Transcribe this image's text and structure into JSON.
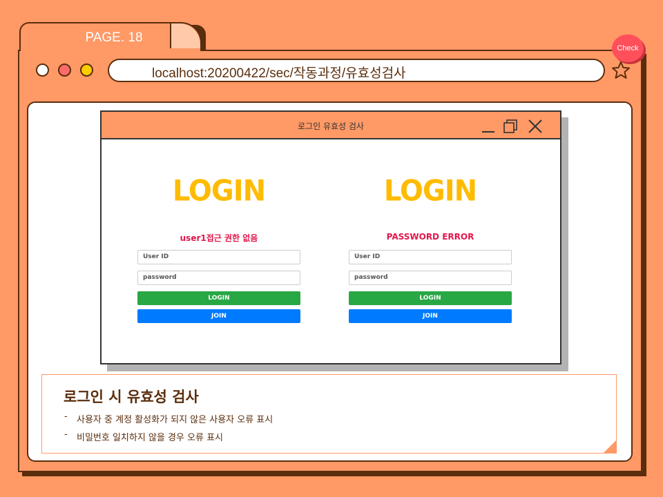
{
  "tab": {
    "title": "PAGE. 18"
  },
  "address_bar": {
    "url": "localhost:20200422/sec/작동과정/유효성검사"
  },
  "badge": {
    "label": "Check"
  },
  "window": {
    "title": "로그인 유효성 검사",
    "forms": [
      {
        "logo": "LOGIN",
        "error": "user1접근 권한 없음",
        "userid_placeholder": "User ID",
        "password_placeholder": "password",
        "login_label": "LOGIN",
        "join_label": "JOIN"
      },
      {
        "logo": "LOGIN",
        "error": "PASSWORD ERROR",
        "userid_placeholder": "User ID",
        "password_placeholder": "password",
        "login_label": "LOGIN",
        "join_label": "JOIN"
      }
    ]
  },
  "description": {
    "title": "로그인 시 유효성 검사",
    "items": [
      "사용자 중 계정 활성화가 되지 않은 사용자 오류 표시",
      "비밀번호 일치하지 않을 경우 오류 표시"
    ]
  },
  "colors": {
    "background": "#ff9966",
    "outline": "#5a2d0c",
    "logo": "#ffbb00",
    "error": "#e3164a",
    "login_button": "#28a745",
    "join_button": "#007bff",
    "badge": "#ff4f5a"
  },
  "icons": [
    "star-icon",
    "minimize-icon",
    "maximize-icon",
    "close-icon"
  ]
}
